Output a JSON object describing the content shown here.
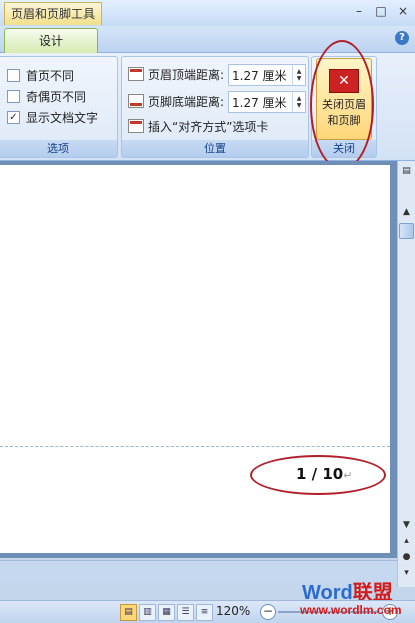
{
  "title_bar": {
    "context_title": "页眉和页脚工具",
    "win_buttons": [
      "–",
      "□",
      "×"
    ]
  },
  "tabs": {
    "design": "设计",
    "help": "?"
  },
  "options_group": {
    "label": "选项",
    "items": [
      {
        "label": "首页不同",
        "checked": false
      },
      {
        "label": "奇偶页不同",
        "checked": false
      },
      {
        "label": "显示文档文字",
        "checked": true
      }
    ]
  },
  "position_group": {
    "label": "位置",
    "header_from_top": {
      "label": "页眉顶端距离:",
      "value": "1.27 厘米"
    },
    "footer_from_bottom": {
      "label": "页脚底端距离:",
      "value": "1.27 厘米"
    },
    "insert_align_tab": "插入“对齐方式”选项卡"
  },
  "close_group": {
    "label": "关闭",
    "button_line1": "关闭页眉",
    "button_line2": "和页脚",
    "icon_glyph": "✕"
  },
  "document": {
    "page_number": "1 / 10",
    "para_mark": "↵"
  },
  "status": {
    "zoom": "120%",
    "zoom_out": "−",
    "zoom_in": "+"
  },
  "watermark": {
    "word": "Word",
    "lm": "联盟",
    "url": "www.wordlm.com"
  },
  "colors": {
    "accent": "#ffd67a",
    "oval": "#b1202a"
  }
}
